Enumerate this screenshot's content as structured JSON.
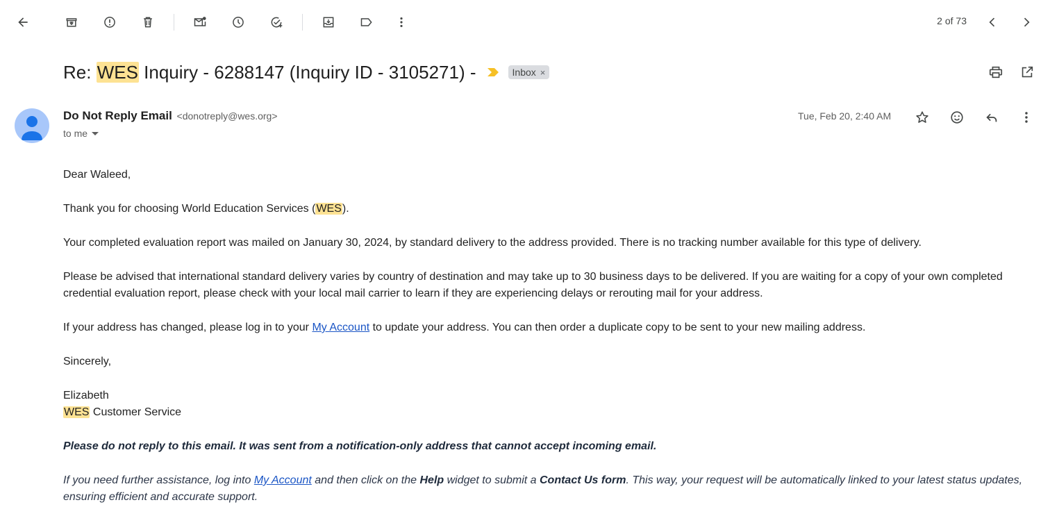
{
  "toolbar": {
    "pager": "2 of 73",
    "icons": [
      "back-arrow-icon",
      "archive-icon",
      "report-spam-icon",
      "delete-icon",
      "mark-unread-icon",
      "snooze-icon",
      "add-task-icon",
      "move-to-icon",
      "label-icon",
      "more-vert-icon",
      "newer-icon",
      "older-icon"
    ]
  },
  "subject": {
    "prefix": "Re: ",
    "highlight": "WES",
    "rest": " Inquiry - 6288147 (Inquiry ID - 3105271) -",
    "label": "Inbox",
    "label_close": "×"
  },
  "sender": {
    "name": "Do Not Reply Email",
    "email": "<donotreply@wes.org>",
    "to": "to me",
    "date": "Tue, Feb 20, 2:40 AM"
  },
  "body": {
    "greeting": "Dear Waleed,",
    "thanks_pre": "Thank you for choosing World Education Services (",
    "thanks_hl": "WES",
    "thanks_post": ").",
    "mailed": "Your completed evaluation report was mailed on January 30, 2024, by standard delivery to the address provided. There is no tracking number available for this type of delivery.",
    "advised": "Please be advised that international standard delivery varies by country of destination and may take up to 30 business days to be delivered. If you are waiting for a copy of your own completed credential evaluation report, please check with your local mail carrier to learn if they are experiencing delays or rerouting mail for your address.",
    "address_pre": "If your address has changed, please log in to your ",
    "address_link": "My Account",
    "address_post": " to update your address. You can then order a duplicate copy to be sent to your new mailing address.",
    "closing": "Sincerely,",
    "signer": "Elizabeth",
    "team_hl": "WES",
    "team_rest": " Customer Service",
    "notice": "Please do not reply to this email. It was sent from a notification-only address that cannot accept incoming email.",
    "help_1": "If you need further assistance, log into ",
    "help_link": "My Account",
    "help_2": " and then click on the ",
    "help_bold1": "Help",
    "help_3": " widget to submit a ",
    "help_bold2": "Contact Us form",
    "help_4": ". This way, your request will be automatically linked to your latest status updates, ensuring efficient and accurate support."
  },
  "colors": {
    "highlight": "#fde293",
    "link": "#1a55c5",
    "importance_marker": "#f6c026",
    "label_chip": "#dadce0",
    "avatar_bg": "#a8c7fa",
    "avatar_fg": "#1a73e8"
  }
}
